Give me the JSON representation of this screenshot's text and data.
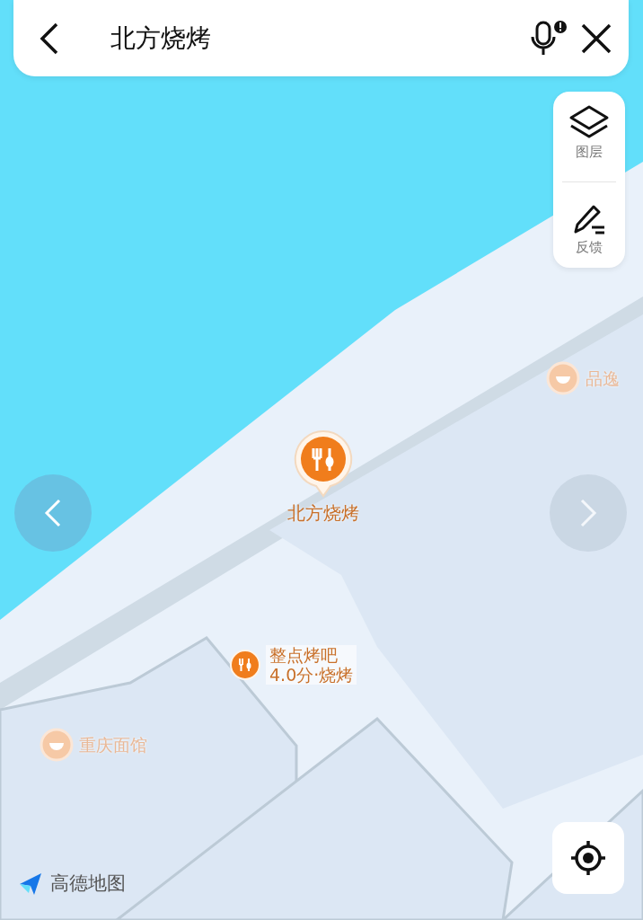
{
  "search": {
    "value": "北方烧烤"
  },
  "side_tools": [
    {
      "label": "图层",
      "kind": "layers"
    },
    {
      "label": "反馈",
      "kind": "feedback"
    }
  ],
  "pois": [
    {
      "kind": "main",
      "name": "北方烧烤"
    },
    {
      "kind": "rated",
      "name": "整点烤吧",
      "detail": "4.0分·烧烤"
    },
    {
      "kind": "faded",
      "name": "重庆面馆"
    },
    {
      "kind": "faded",
      "name": "品逸"
    }
  ],
  "carousel": [
    {
      "kind": "prev",
      "disabled": false
    },
    {
      "kind": "next",
      "disabled": true
    }
  ],
  "logo": {
    "text": "高德地图"
  }
}
